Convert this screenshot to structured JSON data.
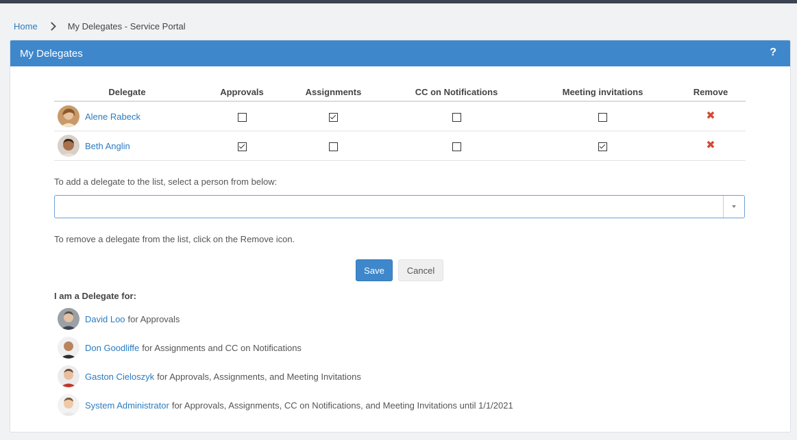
{
  "breadcrumb": {
    "home": "Home",
    "current": "My Delegates - Service Portal"
  },
  "panel": {
    "title": "My Delegates",
    "help": "?"
  },
  "table": {
    "columns": [
      "Delegate",
      "Approvals",
      "Assignments",
      "CC on Notifications",
      "Meeting invitations",
      "Remove"
    ],
    "rows": [
      {
        "name": "Alene Rabeck",
        "approvals": false,
        "assignments": true,
        "cc": false,
        "meetings": false
      },
      {
        "name": "Beth Anglin",
        "approvals": true,
        "assignments": false,
        "cc": false,
        "meetings": true
      }
    ],
    "remove_icon": "✖"
  },
  "add_instruction": "To add a delegate to the list, select a person from below:",
  "select": {
    "value": ""
  },
  "remove_instruction": "To remove a delegate from the list, click on the Remove icon.",
  "buttons": {
    "save": "Save",
    "cancel": "Cancel"
  },
  "delegate_for": {
    "title": "I am a Delegate for:",
    "items": [
      {
        "name": "David Loo",
        "text": "for Approvals"
      },
      {
        "name": "Don Goodliffe",
        "text": "for Assignments and CC on Notifications"
      },
      {
        "name": "Gaston Cieloszyk",
        "text": "for Approvals, Assignments, and Meeting Invitations"
      },
      {
        "name": "System Administrator",
        "text": "for Approvals, Assignments, CC on Notifications, and Meeting Invitations until 1/1/2021"
      }
    ]
  },
  "colors": {
    "accent": "#3f87cb",
    "link": "#2b7bc0",
    "remove": "#d34a32"
  }
}
